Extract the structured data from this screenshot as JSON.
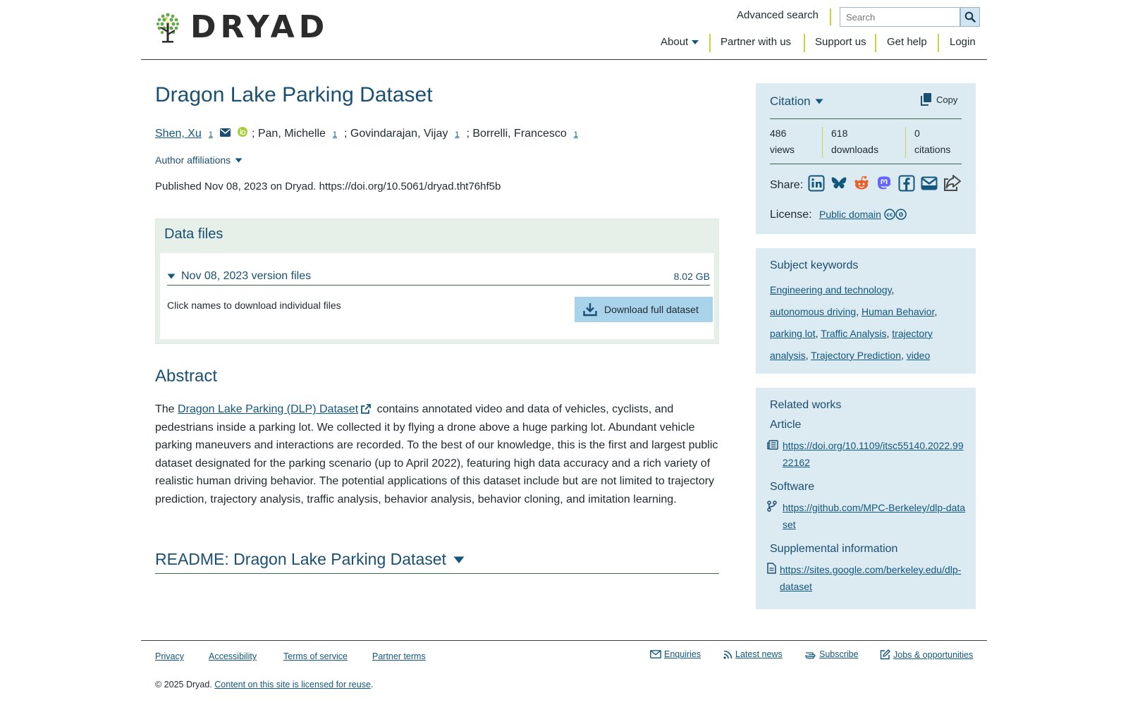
{
  "header": {
    "logo_text": "DRYAD",
    "advanced_search": "Advanced search",
    "search_placeholder": "Search",
    "nav": {
      "about": "About",
      "partner": "Partner with us",
      "support": "Support us",
      "help": "Get help",
      "login": "Login"
    }
  },
  "dataset": {
    "title": "Dragon Lake Parking Dataset",
    "authors": [
      {
        "name": "Shen, Xu",
        "aff": "1"
      },
      {
        "name": "; Pan, Michelle",
        "aff": "1"
      },
      {
        "name": "; Govindarajan, Vijay",
        "aff": "1"
      },
      {
        "name": "; Borrelli, Francesco",
        "aff": "1"
      }
    ],
    "author_affiliations": "Author affiliations",
    "published": "Published Nov 08, 2023 on Dryad. https://doi.org/10.5061/dryad.tht76hf5b"
  },
  "data_files": {
    "heading": "Data files",
    "version_label": "Nov 08, 2023 version files",
    "version_size": "8.02 GB",
    "instructions": "Click names to download individual files",
    "download_button": "Download full dataset"
  },
  "abstract": {
    "heading": "Abstract",
    "pre": "The ",
    "link_text": "Dragon Lake Parking (DLP) Dataset",
    "post": " contains annotated video and data of vehicles, cyclists, and pedestrians inside a parking lot. We collected it by flying a drone above a huge parking lot. Abundant vehicle parking maneuvers and interactions are recorded. To the best of our knowledge, this is the first and largest public dataset designated for the parking scenario (up to April 2022), featuring high data accuracy and a rich variety of realistic human driving behavior. The potential applications of this dataset include but are not limited to trajectory prediction, trajectory analysis, traffic analysis, behavior analysis, behavior cloning, and imitation learning."
  },
  "readme": {
    "label": "README: Dragon Lake Parking Dataset"
  },
  "sidebar": {
    "citation_label": "Citation",
    "copy_label": "Copy",
    "stats": [
      {
        "value": "486",
        "label": "views"
      },
      {
        "value": "618",
        "label": "downloads"
      },
      {
        "value": "0",
        "label": "citations"
      }
    ],
    "share_label": "Share:",
    "license_label": "License:",
    "license_value": "Public domain",
    "keywords_heading": "Subject keywords",
    "keywords": [
      "Engineering and technology",
      "autonomous driving",
      "Human Behavior",
      "parking lot",
      "Traffic Analysis",
      "trajectory analysis",
      "Trajectory Prediction",
      "video"
    ],
    "related_heading": "Related works",
    "article_heading": "Article",
    "article_link": "https://doi.org/10.1109/itsc55140.2022.9922162",
    "software_heading": "Software",
    "software_link": "https://github.com/MPC-Berkeley/dlp-dataset",
    "supplemental_heading": "Supplemental information",
    "supplemental_link": "https://sites.google.com/berkeley.edu/dlp-dataset"
  },
  "footer": {
    "privacy": "Privacy",
    "accessibility": "Accessibility",
    "terms": "Terms of service",
    "partner_terms": "Partner terms",
    "enquiries": "Enquiries",
    "news": "Latest news",
    "subscribe": "Subscribe",
    "jobs": "Jobs & opportunities",
    "copyright_pre": "© 2025 Dryad. ",
    "copyright_link": "Content on this site is licensed for reuse",
    "copyright_post": "."
  },
  "colors": {
    "brand_blue": "#1b4f72",
    "link_blue": "#12577d",
    "accent_lime": "#c8d43c",
    "panel_blue": "#dceaf2",
    "panel_green": "#e6f0e8"
  }
}
